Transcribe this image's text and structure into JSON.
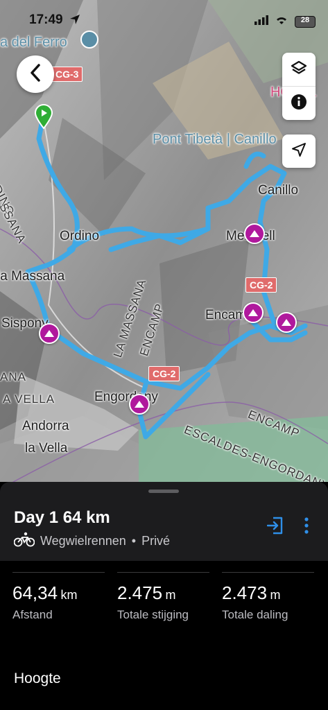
{
  "status_bar": {
    "time": "17:49",
    "battery": "28"
  },
  "map": {
    "labels": {
      "del_ferro": "a del Ferro",
      "hotel_fragment": "HOTEL",
      "pont_tibeta": "Pont Tibetà | Canillo",
      "canillo": "Canillo",
      "ordino_region": "ORDINO",
      "massana_region": "SSANA",
      "ordino": "Ordino",
      "meritxell": "Meritxell",
      "la_massana": "la Massana",
      "la_massana_encamp": "LA MASSANA",
      "encamp_region_1": "ENCAMP",
      "encamp": "Encamp",
      "sispony": "Sispony",
      "ana_region": "ANA",
      "vella_region": "A VELLA",
      "engordany": "Engordany",
      "andorra": "Andorra",
      "la_vella": "la Vella",
      "encamp_region_2": "ENCAMP",
      "escaldes_region": "ESCALDES-ENGORDANY"
    },
    "road_badges": [
      "CG-3",
      "CG-2",
      "CG-2"
    ]
  },
  "route": {
    "title": "Day 1 64 km",
    "activity": "Wegwielrennen",
    "visibility": "Privé",
    "separator": "•"
  },
  "stats": [
    {
      "value": "64,34",
      "unit": "km",
      "label": "Afstand"
    },
    {
      "value": "2.475",
      "unit": "m",
      "label": "Totale stijging"
    },
    {
      "value": "2.473",
      "unit": "m",
      "label": "Totale daling"
    }
  ],
  "section_title": "Hoogte",
  "colors": {
    "route": "#3fa9e6",
    "marker": "#b0199d",
    "accent": "#2f8fe8",
    "start": "#2fae35"
  }
}
